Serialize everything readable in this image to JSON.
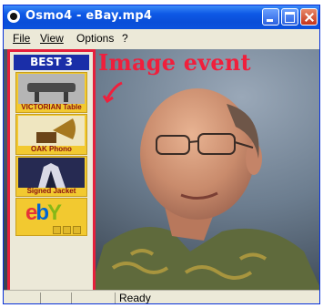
{
  "window": {
    "title": "Osmo4 - eBay.mp4"
  },
  "menu": [
    {
      "id": "file",
      "label": "File"
    },
    {
      "id": "view",
      "label": "View"
    },
    {
      "id": "options",
      "label": "Options"
    },
    {
      "id": "help",
      "label": "?"
    }
  ],
  "overlay": {
    "label": "Image event",
    "color": "#f01f3c"
  },
  "sidebar": {
    "header": "BEST 3",
    "items": [
      {
        "caption": "VICTORIAN Table",
        "icon": "table-thumbnail-icon"
      },
      {
        "caption": "OAK Phono",
        "icon": "phonograph-thumbnail-icon"
      },
      {
        "caption": "Signed Jacket",
        "icon": "jacket-thumbnail-icon"
      }
    ],
    "logo": "ebY",
    "border_color": "#e5203c"
  },
  "status": {
    "text": "Ready"
  }
}
